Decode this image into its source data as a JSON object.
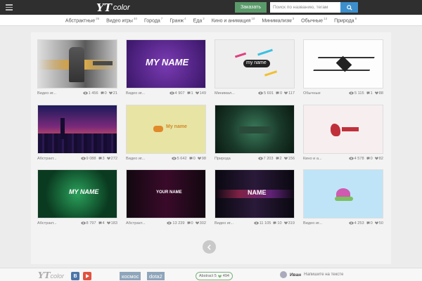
{
  "header": {
    "logo_prefix": "YT",
    "logo_text": "color",
    "order_label": "Заказать",
    "search_placeholder": "Поиск по названию, тегам"
  },
  "categories": [
    {
      "label": "Абстрактные",
      "count": "26"
    },
    {
      "label": "Видео игры",
      "count": "40"
    },
    {
      "label": "Города",
      "count": "7"
    },
    {
      "label": "Гранж",
      "count": "4"
    },
    {
      "label": "Еда",
      "count": "2"
    },
    {
      "label": "Кино и анимация",
      "count": "10"
    },
    {
      "label": "Минимализм",
      "count": "3"
    },
    {
      "label": "Обычные",
      "count": "13"
    },
    {
      "label": "Природа",
      "count": "8"
    }
  ],
  "cards": [
    {
      "category": "Видео иг...",
      "views": "1 456",
      "comments": "0",
      "likes": "21"
    },
    {
      "category": "Видео иг...",
      "views": "4 907",
      "comments": "1",
      "likes": "149",
      "thumb_text": "MY NAME"
    },
    {
      "category": "Минимал...",
      "views": "5 691",
      "comments": "0",
      "likes": "117",
      "thumb_text": "my name"
    },
    {
      "category": "Обычные",
      "views": "5 115",
      "comments": "1",
      "likes": "88"
    },
    {
      "category": "Абстракт...",
      "views": "9 088",
      "comments": "3",
      "likes": "272"
    },
    {
      "category": "Видео иг...",
      "views": "5 642",
      "comments": "0",
      "likes": "98",
      "thumb_text": "My name"
    },
    {
      "category": "Природа",
      "views": "7 203",
      "comments": "2",
      "likes": "156"
    },
    {
      "category": "Кино и а...",
      "views": "4 578",
      "comments": "0",
      "likes": "82"
    },
    {
      "category": "Абстракт...",
      "views": "8 797",
      "comments": "4",
      "likes": "183",
      "thumb_text": "MY NAME"
    },
    {
      "category": "Абстракт...",
      "views": "13 239",
      "comments": "0",
      "likes": "302",
      "thumb_text": "YOUR NAME"
    },
    {
      "category": "Видео иг...",
      "views": "11 105",
      "comments": "10",
      "likes": "319",
      "thumb_text": "NAME"
    },
    {
      "category": "Видео иг...",
      "views": "4 253",
      "comments": "0",
      "likes": "50"
    }
  ],
  "footer": {
    "logo_prefix": "YT",
    "logo_text": "color",
    "vk_label": "B",
    "tags": [
      "космос",
      "dota2"
    ],
    "badge_label": "Abstract 5",
    "badge_count": "494",
    "user_name": "Иван",
    "user_comment": "Напишите на тексте"
  },
  "colors": {
    "topbar": "#2f2f2f",
    "order_button": "#5a9a6a",
    "search_button": "#3d8fcc",
    "vk": "#4a76a8",
    "youtube": "#e0533f"
  }
}
